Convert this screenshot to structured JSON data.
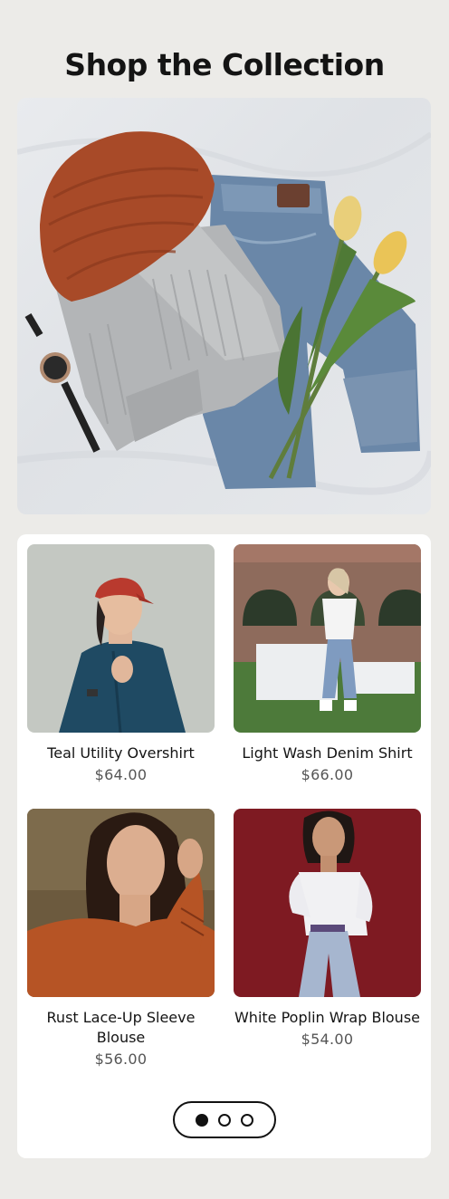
{
  "page": {
    "title": "Shop the Collection"
  },
  "products": [
    {
      "name": "Teal Utility Overshirt",
      "price": "$64.00"
    },
    {
      "name": "Light Wash Denim Shirt",
      "price": "$66.00"
    },
    {
      "name": "Rust Lace-Up Sleeve Blouse",
      "price": "$56.00"
    },
    {
      "name": "White Poplin Wrap Blouse",
      "price": "$54.00"
    }
  ],
  "pagination": {
    "active_index": 0,
    "count": 3
  },
  "colors": {
    "background": "#ecebe8",
    "card": "#ffffff",
    "text": "#141414",
    "price": "#555555"
  }
}
